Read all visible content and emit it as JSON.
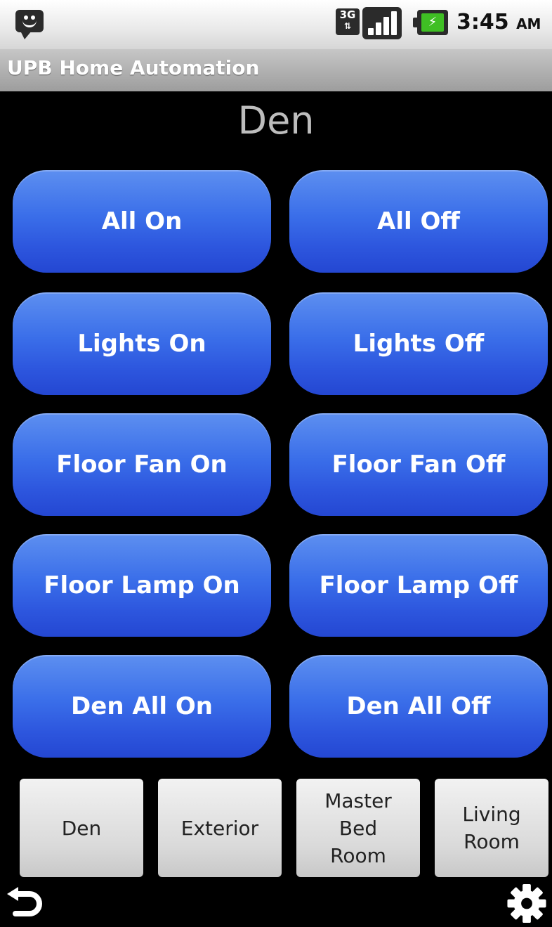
{
  "status_bar": {
    "time": "3:45",
    "ampm": "AM",
    "network_label": "3G",
    "network_arrows": "⇅",
    "battery_bolt": "⚡",
    "icons": [
      "notification-smiley-icon",
      "3g-data-icon",
      "signal-strength-icon",
      "battery-charging-icon"
    ],
    "battery_color": "#3fbf24"
  },
  "app": {
    "title": "UPB Home Automation"
  },
  "room": {
    "title": "Den"
  },
  "actions": [
    {
      "label": "All On"
    },
    {
      "label": "All Off"
    },
    {
      "label": "Lights On"
    },
    {
      "label": "Lights Off"
    },
    {
      "label": "Floor Fan On"
    },
    {
      "label": "Floor Fan Off"
    },
    {
      "label": "Floor Lamp On"
    },
    {
      "label": "Floor Lamp Off"
    },
    {
      "label": "Den All On"
    },
    {
      "label": "Den All Off"
    }
  ],
  "rooms": [
    {
      "label": "Den"
    },
    {
      "label": "Exterior"
    },
    {
      "label": "Master\nBed\nRoom"
    },
    {
      "label": "Living\nRoom"
    }
  ],
  "footer": {
    "icons": [
      "back-icon",
      "settings-gear-icon"
    ]
  },
  "colors": {
    "button_blue_top": "#5d8ff0",
    "button_blue_bottom": "#2447d2",
    "room_title_gray": "#bdbdbd",
    "background": "#000000"
  }
}
